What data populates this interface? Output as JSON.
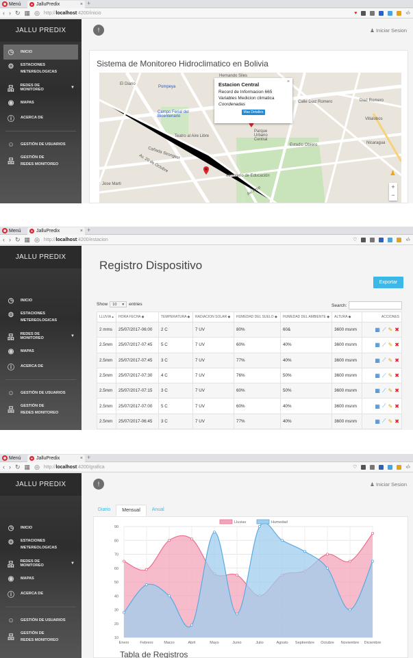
{
  "browser": {
    "menu_label": "Menú",
    "tab_title": "JalluPredix",
    "tab_close": "×",
    "new_tab": "+",
    "url_prefix": "http://",
    "url_host": "localhost",
    "shots": [
      {
        "url_path": ":4200/inicio"
      },
      {
        "url_path": ":4200/estacion"
      },
      {
        "url_path": ":4200/grafica"
      }
    ]
  },
  "sidebar": {
    "brand": "JALLU PREDIX",
    "brand_alt": "JALLU PREDIX",
    "items": [
      {
        "label": "INICIO"
      },
      {
        "label": "ESTACIONES",
        "label2": "METEREOLOGICAS"
      },
      {
        "label": "REDES DE MONITOREO"
      },
      {
        "label": "MAPAS"
      },
      {
        "label": "ACERCA DE"
      },
      {
        "label": "GESTIÓN DE USUARIOS"
      },
      {
        "label": "GESTIÓN DE",
        "label2": "REDES MONITOREO"
      }
    ]
  },
  "topbar": {
    "circle_glyph": "!",
    "login_label": "Iniciar Sesion"
  },
  "inicio": {
    "title": "Sistema de Monitoreo Hidroclimatico en Bolivia",
    "info": {
      "title": "Estacion Central",
      "line1": "Record de Informacion 665",
      "line2": "Variables Medicion climatica",
      "line3": "Coordenadas",
      "button": "Mas Detalles",
      "close": "×"
    },
    "map_labels": [
      "Hernando Siles",
      "El Diario",
      "Pompeya",
      "Campo Ferial del Bicentenario",
      "Teatro al Aire Libre",
      "Parque Urbano Central",
      "Estadio Obrero",
      "Diaz Romero",
      "Villalobos",
      "Nicaragua",
      "Ministerio de Educación",
      "Jose Marti",
      "Cañada Strongest",
      "Av. 20 de Octubre",
      "Av. Arce",
      "Calle Diaz Romero"
    ]
  },
  "registro": {
    "title": "Registro Dispositivo",
    "export": "Exportar",
    "show_label": "Show",
    "show_value": "10",
    "entries_label": "entries",
    "search_label": "Search:",
    "columns": [
      "LLUVIA",
      "HORA FECHA",
      "TEMPERATURA",
      "RADIACION SOLAR",
      "HUMEDAD DEL SUELO",
      "HUMEDAD DEL AMBIENTE",
      "ALTURA",
      "ACCIONES"
    ],
    "rows": [
      [
        "2 mms",
        "25/07/2017-06:00",
        "2 C",
        "7 UV",
        "80%",
        "60&",
        "3600 msnm"
      ],
      [
        "2.5mm",
        "25/07/2017-07:45",
        "5 C",
        "7 UV",
        "60%",
        "40%",
        "3600 msnm"
      ],
      [
        "2.5mm",
        "25/07/2017-07:45",
        "3 C",
        "7 UV",
        "77%",
        "40%",
        "3600 msnm"
      ],
      [
        "2.5mm",
        "25/07/2017-07:30",
        "4 C",
        "7 UV",
        "76%",
        "50%",
        "3600 msnm"
      ],
      [
        "2.5mm",
        "25/07/2017-07:15",
        "3 C",
        "7 UV",
        "60%",
        "50%",
        "3600 msnm"
      ],
      [
        "2.5mm",
        "25/07/2017-07:00",
        "5 C",
        "7 UV",
        "60%",
        "40%",
        "3600 msnm"
      ],
      [
        "2.5mm",
        "25/07/2017-06:45",
        "3 C",
        "7 UV",
        "77%",
        "40%",
        "3600 msnm"
      ]
    ],
    "colors": {
      "table_icon": "#2a78c8",
      "chart_icon": "#3ba3d9",
      "edit_icon": "#e6a21a",
      "delete_icon": "#d9262c"
    }
  },
  "grafica": {
    "tabs": [
      "Diario",
      "Mensual",
      "Anual"
    ],
    "active_tab": 1,
    "tabla_title": "Tabla de Registros"
  },
  "chart_data": {
    "type": "area",
    "categories": [
      "Enero",
      "Febrero",
      "Marzo",
      "Abril",
      "Mayo",
      "Junio",
      "Julio",
      "Agosto",
      "Septiembre",
      "Octubre",
      "Noviembre",
      "Diciembre"
    ],
    "series": [
      {
        "name": "Lluvias",
        "values": [
          65,
          59,
          80,
          81,
          56,
          55,
          40,
          55,
          58,
          70,
          65,
          85
        ],
        "color": "#f3a6bb",
        "stroke": "#e8708f"
      },
      {
        "name": "Humedad",
        "values": [
          28,
          48,
          40,
          19,
          86,
          27,
          90,
          80,
          72,
          60,
          30,
          65
        ],
        "color": "#9fcdee",
        "stroke": "#5aa9e0"
      }
    ],
    "ylim": [
      10,
      90
    ],
    "yticks": [
      10,
      20,
      30,
      40,
      50,
      60,
      70,
      80,
      90
    ],
    "grid": true,
    "legend": "top-center"
  }
}
